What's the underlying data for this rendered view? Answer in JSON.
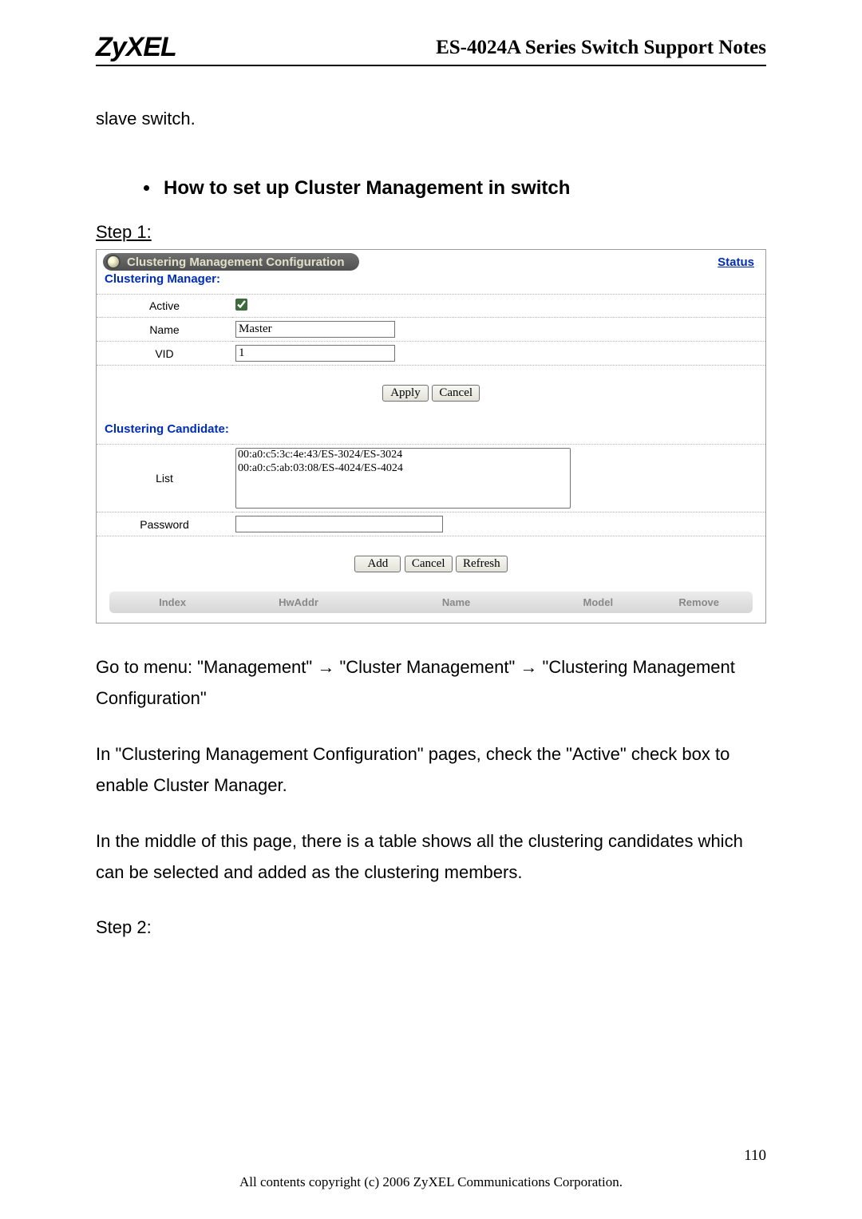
{
  "header": {
    "logo": "ZyXEL",
    "doc_title": "ES-4024A Series Switch Support Notes"
  },
  "intro_text": "slave switch.",
  "section_heading": "How to set up Cluster Management in switch",
  "step1_label": "Step 1:",
  "panel": {
    "tab_title": "Clustering Management Configuration",
    "status_link": "Status",
    "manager_heading": "Clustering Manager:",
    "labels": {
      "active": "Active",
      "name": "Name",
      "vid": "VID",
      "list": "List",
      "password": "Password"
    },
    "values": {
      "name": "Master",
      "vid": "1",
      "list_option_1": "00:a0:c5:3c:4e:43/ES-3024/ES-3024",
      "list_option_2": "00:a0:c5:ab:03:08/ES-4024/ES-4024"
    },
    "candidate_heading": "Clustering Candidate:",
    "buttons": {
      "apply": "Apply",
      "cancel": "Cancel",
      "add": "Add",
      "refresh": "Refresh"
    },
    "members_header": {
      "index": "Index",
      "hwaddr": "HwAddr",
      "name": "Name",
      "model": "Model",
      "remove": "Remove"
    }
  },
  "para1_prefix": "Go to menu: \"Management\" ",
  "para1_mid1": " \"Cluster Management\" ",
  "para1_suffix": " \"Clustering Management Configuration\"",
  "para2": "In \"Clustering Management Configuration\" pages, check the \"Active\" check box to enable Cluster Manager.",
  "para3": "In the middle of this page, there is a table shows all the clustering candidates which can be selected and added as the clustering members.",
  "step2_label": "Step 2:",
  "page_number": "110",
  "footer": "All contents copyright (c) 2006 ZyXEL Communications Corporation."
}
